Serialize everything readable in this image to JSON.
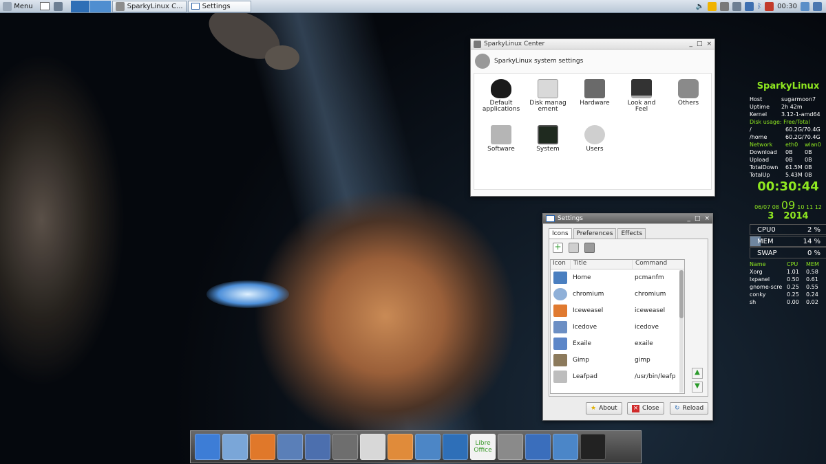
{
  "taskbar": {
    "menu_label": "Menu",
    "tasks": [
      {
        "label": "SparkyLinux C..."
      },
      {
        "label": "Settings"
      }
    ],
    "clock": "00:30"
  },
  "center": {
    "title": "SparkyLinux Center",
    "header": "SparkyLinux system settings",
    "items": [
      {
        "label": "Default applications",
        "icon": "heart-icon",
        "color": "#1a1a1a"
      },
      {
        "label": "Disk management",
        "icon": "disk-icon",
        "color": "#d9d9d9"
      },
      {
        "label": "Hardware",
        "icon": "hardware-icon",
        "color": "#6a6a6a"
      },
      {
        "label": "Look and Feel",
        "icon": "monitor-icon",
        "color": "#333333"
      },
      {
        "label": "Others",
        "icon": "gear-icon",
        "color": "#8a8a8a"
      },
      {
        "label": "Software",
        "icon": "software-icon",
        "color": "#b5b5b5"
      },
      {
        "label": "System",
        "icon": "system-monitor-icon",
        "color": "#1f2a1f"
      },
      {
        "label": "Users",
        "icon": "users-icon",
        "color": "#cfcfcf"
      }
    ]
  },
  "settings": {
    "title": "Settings",
    "tabs": [
      "Icons",
      "Preferences",
      "Effects"
    ],
    "columns": [
      "Icon",
      "Title",
      "Command"
    ],
    "rows": [
      {
        "title": "Home",
        "command": "pcmanfm",
        "color": "#4a7fc0"
      },
      {
        "title": "chromium",
        "command": "chromium",
        "color": "#8fb0d8"
      },
      {
        "title": "Iceweasel",
        "command": "iceweasel",
        "color": "#e07a30"
      },
      {
        "title": "Icedove",
        "command": "icedove",
        "color": "#6c8fc4"
      },
      {
        "title": "Exaile",
        "command": "exaile",
        "color": "#5c86c8"
      },
      {
        "title": "Gimp",
        "command": "gimp",
        "color": "#8c7a5c"
      },
      {
        "title": "Leafpad",
        "command": "/usr/bin/leafp",
        "color": "#bdbdbd"
      }
    ],
    "buttons": {
      "about": "About",
      "close": "Close",
      "reload": "Reload"
    }
  },
  "conky": {
    "title": "SparkyLinux",
    "host_label": "Host",
    "host": "sugarmoon7",
    "uptime_label": "Uptime",
    "uptime": "2h 42m",
    "kernel_label": "Kernel",
    "kernel": "3.12-1-amd64",
    "disk_label": "Disk usage:",
    "disk_cols": "Free/Total",
    "root_label": "/",
    "root": "60.2G/70.4G",
    "home_label": "/home",
    "home": "60.2G/70.4G",
    "net_label": "Network",
    "net_if1": "eth0",
    "net_if2": "wlan0",
    "download_label": "Download",
    "download1": "0B",
    "download2": "0B",
    "upload_label": "Upload",
    "upload1": "0B",
    "upload2": "0B",
    "totaldown_label": "TotalDown",
    "totaldown1": "61.5M",
    "totaldown2": "0B",
    "totalup_label": "TotalUp",
    "totalup1": "5.43M",
    "totalup2": "0B",
    "time": "00:30:44",
    "date_small_left": "06/07 08",
    "date_big": "09",
    "date_small_right": "10 11 12",
    "month": "3",
    "year": "2014",
    "cpu_label": "CPU0",
    "cpu": "2 %",
    "mem_label": "MEM",
    "mem": "14 %",
    "mem_level": 0.14,
    "swap_label": "SWAP",
    "swap": "0 %",
    "proc_head": {
      "name": "Name",
      "cpu": "CPU",
      "mem": "MEM"
    },
    "procs": [
      {
        "name": "Xorg",
        "cpu": "1.01",
        "mem": "0.58"
      },
      {
        "name": "lxpanel",
        "cpu": "0.50",
        "mem": "0.61"
      },
      {
        "name": "gnome-scre",
        "cpu": "0.25",
        "mem": "0.55"
      },
      {
        "name": "conky",
        "cpu": "0.25",
        "mem": "0.24"
      },
      {
        "name": "sh",
        "cpu": "0.00",
        "mem": "0.02"
      }
    ]
  },
  "dock": {
    "libre_label": "Libre Office",
    "icons": [
      {
        "icon": "desktop-icon",
        "color": "#3d7dd6"
      },
      {
        "icon": "chromium-icon",
        "color": "#7aa6d8"
      },
      {
        "icon": "iceweasel-icon",
        "color": "#e0782a"
      },
      {
        "icon": "icedove-icon",
        "color": "#5a7fb8"
      },
      {
        "icon": "music-note-icon",
        "color": "#4c6fae"
      },
      {
        "icon": "eyes-icon",
        "color": "#6e6e6e"
      },
      {
        "icon": "leafpad-icon",
        "color": "#d8d8d8"
      },
      {
        "icon": "notes-icon",
        "color": "#e08b3a"
      },
      {
        "icon": "sparky-icon",
        "color": "#4c86c6"
      },
      {
        "icon": "kde-icon",
        "color": "#2e6fb8"
      },
      {
        "icon": "libreoffice-icon",
        "color": "#f2f2f2"
      },
      {
        "icon": "clock-icon",
        "color": "#8a8a8a"
      },
      {
        "icon": "media-player-icon",
        "color": "#3a6ebc"
      },
      {
        "icon": "network-icon",
        "color": "#4b86c8"
      },
      {
        "icon": "terminal-icon",
        "color": "#222222"
      }
    ]
  }
}
